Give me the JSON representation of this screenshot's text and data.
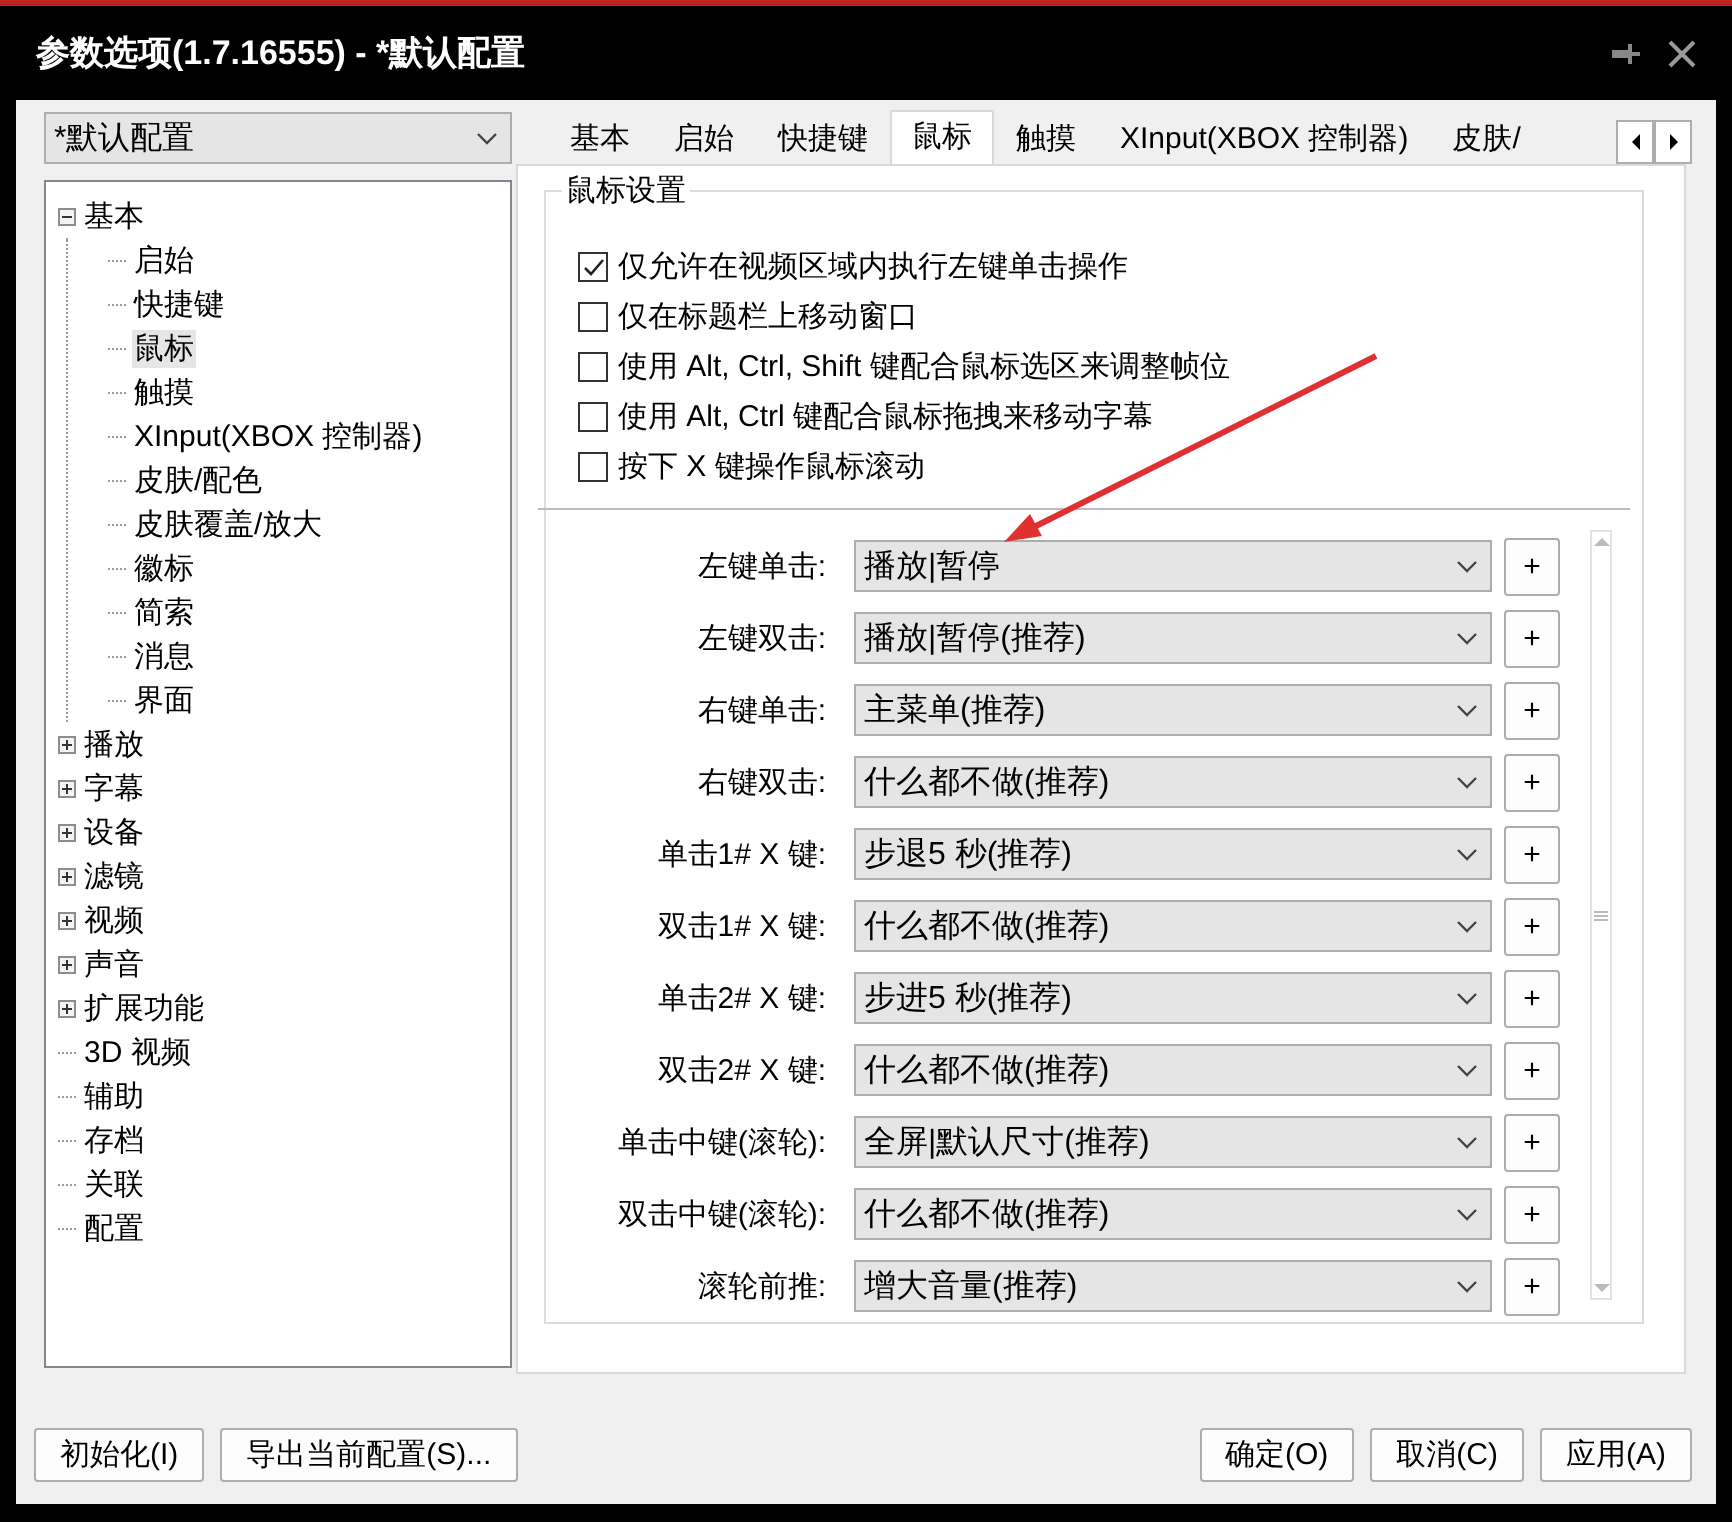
{
  "window": {
    "title": "参数选项(1.7.16555) - *默认配置"
  },
  "profile": {
    "value": "*默认配置"
  },
  "tree": [
    {
      "label": "基本",
      "expanded": true,
      "selected": false,
      "children": [
        {
          "label": "启始",
          "selected": false
        },
        {
          "label": "快捷键",
          "selected": false
        },
        {
          "label": "鼠标",
          "selected": true
        },
        {
          "label": "触摸",
          "selected": false
        },
        {
          "label": "XInput(XBOX 控制器)",
          "selected": false
        },
        {
          "label": "皮肤/配色",
          "selected": false
        },
        {
          "label": "皮肤覆盖/放大",
          "selected": false
        },
        {
          "label": "徽标",
          "selected": false
        },
        {
          "label": "简索",
          "selected": false
        },
        {
          "label": "消息",
          "selected": false
        },
        {
          "label": "界面",
          "selected": false
        }
      ]
    },
    {
      "label": "播放",
      "expanded": false,
      "selected": false
    },
    {
      "label": "字幕",
      "expanded": false,
      "selected": false
    },
    {
      "label": "设备",
      "expanded": false,
      "selected": false
    },
    {
      "label": "滤镜",
      "expanded": false,
      "selected": false
    },
    {
      "label": "视频",
      "expanded": false,
      "selected": false
    },
    {
      "label": "声音",
      "expanded": false,
      "selected": false
    },
    {
      "label": "扩展功能",
      "expanded": false,
      "selected": false
    },
    {
      "label": "3D 视频",
      "selected": false
    },
    {
      "label": "辅助",
      "selected": false
    },
    {
      "label": "存档",
      "selected": false
    },
    {
      "label": "关联",
      "selected": false
    },
    {
      "label": "配置",
      "selected": false
    }
  ],
  "tabs": [
    {
      "label": "基本",
      "selected": false
    },
    {
      "label": "启始",
      "selected": false
    },
    {
      "label": "快捷键",
      "selected": false
    },
    {
      "label": "鼠标",
      "selected": true
    },
    {
      "label": "触摸",
      "selected": false
    },
    {
      "label": "XInput(XBOX 控制器)",
      "selected": false
    },
    {
      "label": "皮肤/",
      "selected": false
    }
  ],
  "group": {
    "title": "鼠标设置"
  },
  "checkboxes": [
    {
      "label": "仅允许在视频区域内执行左键单击操作",
      "checked": true
    },
    {
      "label": "仅在标题栏上移动窗口",
      "checked": false
    },
    {
      "label": "使用 Alt, Ctrl, Shift 键配合鼠标选区来调整帧位",
      "checked": false
    },
    {
      "label": "使用 Alt, Ctrl 键配合鼠标拖拽来移动字幕",
      "checked": false
    },
    {
      "label": "按下 X 键操作鼠标滚动",
      "checked": false
    }
  ],
  "actions": [
    {
      "label": "左键单击:",
      "value": "播放|暂停",
      "button": "+"
    },
    {
      "label": "左键双击:",
      "value": "播放|暂停(推荐)",
      "button": "+"
    },
    {
      "label": "右键单击:",
      "value": "主菜单(推荐)",
      "button": "+"
    },
    {
      "label": "右键双击:",
      "value": "什么都不做(推荐)",
      "button": "+"
    },
    {
      "label": "单击1# X 键:",
      "value": "步退5 秒(推荐)",
      "button": "+"
    },
    {
      "label": "双击1# X 键:",
      "value": "什么都不做(推荐)",
      "button": "+"
    },
    {
      "label": "单击2# X 键:",
      "value": "步进5 秒(推荐)",
      "button": "+"
    },
    {
      "label": "双击2# X 键:",
      "value": "什么都不做(推荐)",
      "button": "+"
    },
    {
      "label": "单击中键(滚轮):",
      "value": "全屏|默认尺寸(推荐)",
      "button": "+"
    },
    {
      "label": "双击中键(滚轮):",
      "value": "什么都不做(推荐)",
      "button": "+"
    },
    {
      "label": "滚轮前推:",
      "value": "增大音量(推荐)",
      "button": "+"
    }
  ],
  "footer_left": [
    "初始化(I)",
    "导出当前配置(S)..."
  ],
  "footer_right": [
    "确定(O)",
    "取消(C)",
    "应用(A)"
  ]
}
